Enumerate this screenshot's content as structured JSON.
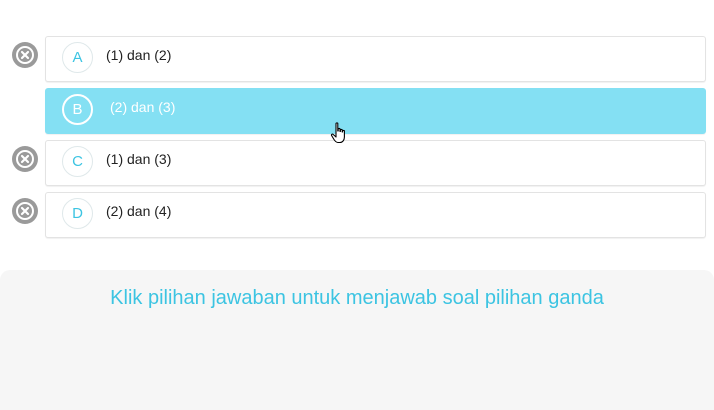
{
  "options": [
    {
      "letter": "A",
      "text": "(1) dan (2)",
      "selected": false
    },
    {
      "letter": "B",
      "text": "(2) dan (3)",
      "selected": true
    },
    {
      "letter": "C",
      "text": "(1) dan (3)",
      "selected": false
    },
    {
      "letter": "D",
      "text": "(2) dan (4)",
      "selected": false
    }
  ],
  "hint": "Klik pilihan jawaban untuk menjawab soal pilihan ganda",
  "colors": {
    "accent": "#3cc4e2",
    "selected_bg": "#84e0f3",
    "eliminate": "#9a9a9a"
  }
}
